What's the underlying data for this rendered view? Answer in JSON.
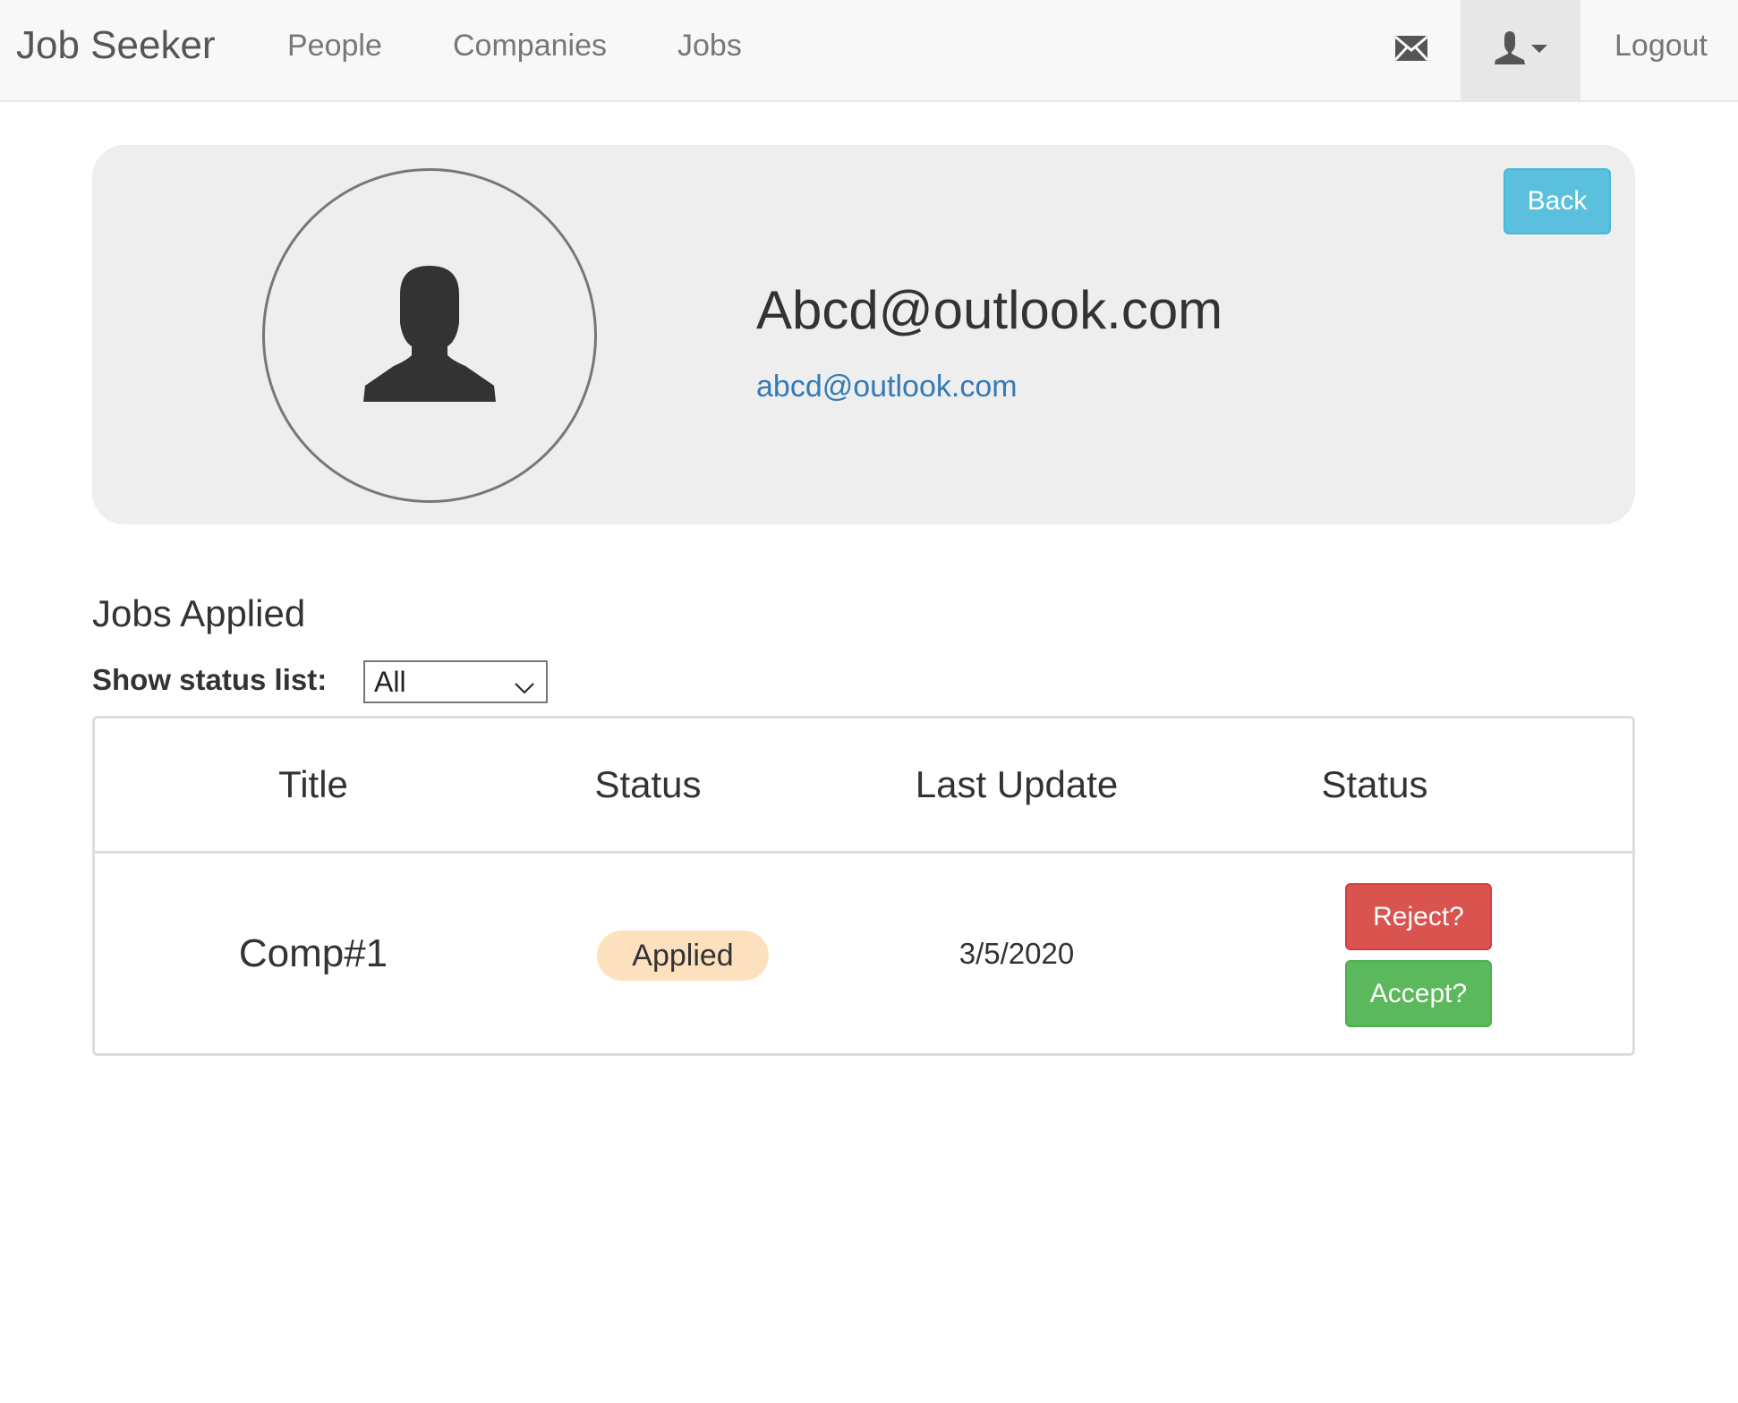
{
  "navbar": {
    "brand": "Job Seeker",
    "links": [
      "People",
      "Companies",
      "Jobs"
    ],
    "mail_icon": "envelope-icon",
    "user_icon": "user-dropdown-icon",
    "logout": "Logout"
  },
  "profile": {
    "name": "Abcd@outlook.com",
    "email": "abcd@outlook.com",
    "back_label": "Back",
    "avatar_icon": "user-silhouette-icon"
  },
  "jobs": {
    "section_title": "Jobs Applied",
    "filter_label": "Show status list:",
    "filter_value": "All",
    "columns": [
      "Title",
      "Status",
      "Last Update",
      "Status"
    ],
    "rows": [
      {
        "title": "Comp#1",
        "status": "Applied",
        "last_update": "3/5/2020",
        "reject_label": "Reject?",
        "accept_label": "Accept?"
      }
    ]
  },
  "colors": {
    "navbar_bg": "#f8f8f8",
    "panel_bg": "#eeeeee",
    "link": "#337ab7",
    "info": "#5bc0de",
    "danger": "#d9534f",
    "success": "#5cb85c",
    "badge": "#fde1bf"
  }
}
